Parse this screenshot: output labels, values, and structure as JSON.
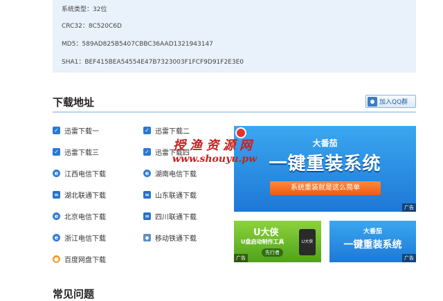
{
  "info": {
    "system_type": "系统类型：32位",
    "crc32": "CRC32：8C520C6D",
    "md5": "MD5：589AD825B5407CBBC36AAD1321943147",
    "sha1": "SHA1：BEF415BEA54554E47B7323003F1FCF9D91F2E3E0"
  },
  "download_section": {
    "title": "下载地址",
    "qq_button": "加入QQ群",
    "items": [
      {
        "label": "迅雷下载一",
        "icon": "thunder-icon"
      },
      {
        "label": "迅雷下载二",
        "icon": "thunder-icon"
      },
      {
        "label": "迅雷下载三",
        "icon": "thunder-icon"
      },
      {
        "label": "迅雷下载四",
        "icon": "thunder-icon"
      },
      {
        "label": "江西电信下载",
        "icon": "telecom-icon"
      },
      {
        "label": "湖南电信下载",
        "icon": "telecom-icon"
      },
      {
        "label": "湖北联通下载",
        "icon": "unicom-icon"
      },
      {
        "label": "山东联通下载",
        "icon": "unicom-icon"
      },
      {
        "label": "北京电信下载",
        "icon": "telecom-icon"
      },
      {
        "label": "四川联通下载",
        "icon": "unicom-icon"
      },
      {
        "label": "浙江电信下载",
        "icon": "telecom-icon"
      },
      {
        "label": "移动铁通下载",
        "icon": "mobile-rail-icon"
      },
      {
        "label": "百度网盘下载",
        "icon": "baidu-pan-icon"
      }
    ]
  },
  "ads": {
    "big": {
      "brand": "大番茄",
      "headline": "一键重装系统",
      "ribbon": "系统重装就是这么简单",
      "tag": "广告"
    },
    "udaxia": {
      "title": "U大侠",
      "subtitle": "U盘启动制作工具",
      "pill": "先行者",
      "usb_label": "U大侠",
      "tag": "广告"
    },
    "small": {
      "brand": "大番茄",
      "headline": "一键重装系统",
      "tag": "广告"
    }
  },
  "watermark": {
    "line1": "授渔资源网",
    "line2": "www.shouyu.pw"
  },
  "faq_section": {
    "title": "常见问题"
  },
  "colors": {
    "accent": "#2a78d6",
    "info_bg": "#e9f2fb",
    "watermark": "#c62020"
  }
}
